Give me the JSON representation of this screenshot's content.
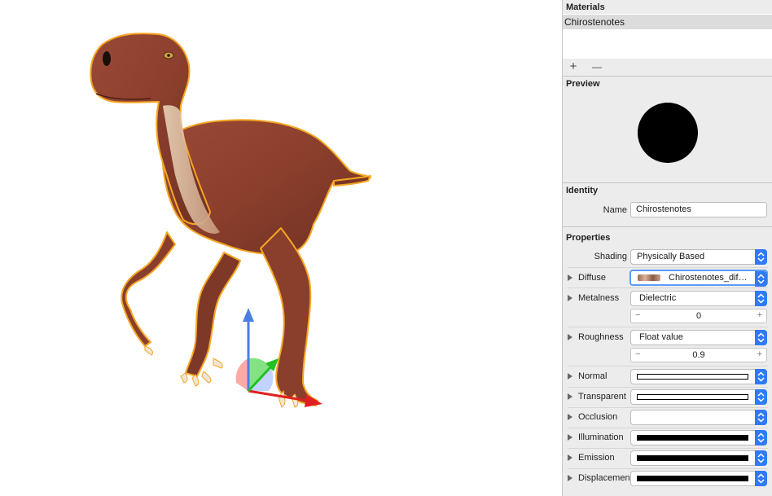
{
  "materials": {
    "title": "Materials",
    "items": [
      "Chirostenotes"
    ],
    "add_label": "+",
    "remove_label": "—"
  },
  "preview": {
    "title": "Preview"
  },
  "identity": {
    "title": "Identity",
    "name_label": "Name",
    "name_value": "Chirostenotes"
  },
  "properties": {
    "title": "Properties",
    "shading_label": "Shading",
    "shading_value": "Physically Based",
    "diffuse_label": "Diffuse",
    "diffuse_value": "Chirostenotes_dif…",
    "metalness_label": "Metalness",
    "metalness_value": "Dielectric",
    "metalness_amount": "0",
    "roughness_label": "Roughness",
    "roughness_value": "Float value",
    "roughness_amount": "0.9",
    "normal_label": "Normal",
    "transparent_label": "Transparent",
    "occlusion_label": "Occlusion",
    "illumination_label": "Illumination",
    "emission_label": "Emission",
    "displacement_label": "Displacemen",
    "stepper_minus": "−",
    "stepper_plus": "+"
  },
  "colors": {
    "accent": "#2d7cf6",
    "selection_outline": "#f5a623",
    "axis_x": "#e02020",
    "axis_y": "#4a7fe0",
    "axis_z": "#22c020"
  },
  "icons": [
    "dinosaur-model",
    "transform-gizmo-icon",
    "disclosure-triangle-icon",
    "popup-arrows-icon"
  ]
}
